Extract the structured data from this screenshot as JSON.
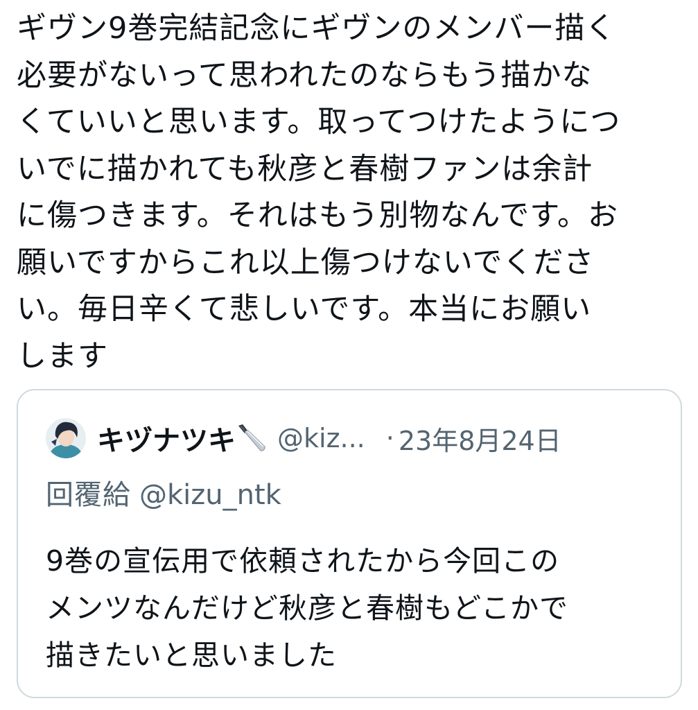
{
  "tweet": {
    "text": "ギヴン9巻完結記念にギヴンのメンバー描く\n必要がないって思われたのならもう描かな\nくていいと思います。取ってつけたようにつ\nいでに描かれても秋彦と春樹ファンは余計\nに傷つきます。それはもう別物なんです。お\n願いですからこれ以上傷つけないでくださ\nい。毎日辛くて悲しいです。本当にお願い\nします"
  },
  "quoted_tweet": {
    "avatar_icon": "user-avatar",
    "author_name": "キヅナツキ",
    "name_emoji_icon": "kitchen-knife-icon",
    "handle": "@kiz...",
    "separator": "·",
    "date": "23年8月24日",
    "reply_label": "回覆給",
    "reply_handle": "@kizu_ntk",
    "text": "9巻の宣伝用で依頼されたから今回この\nメンツなんだけど秋彦と春樹もどこかで\n描きたいと思いました"
  },
  "colors": {
    "text_primary": "#0f1419",
    "text_secondary": "#536471",
    "card_border": "#cfd9de"
  }
}
